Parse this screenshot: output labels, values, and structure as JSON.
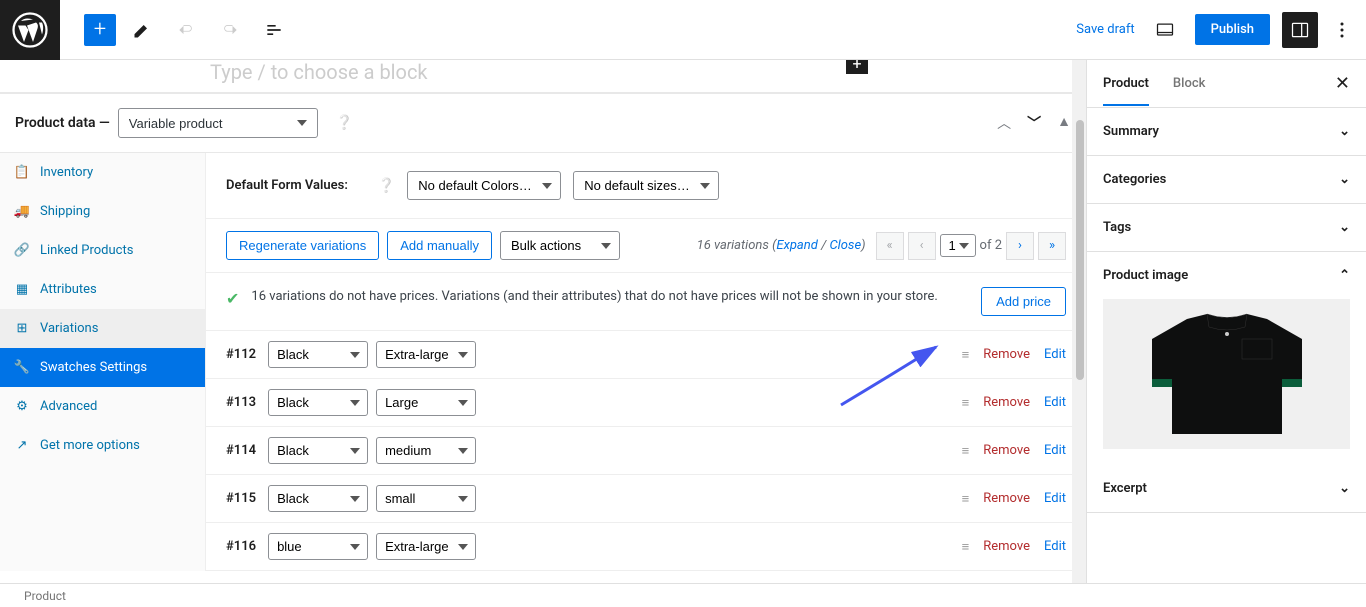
{
  "topbar": {
    "save_draft": "Save draft",
    "publish": "Publish"
  },
  "placeholder_text": "Type / to choose a block",
  "product_data": {
    "label": "Product data —",
    "type": "Variable product"
  },
  "tabs": {
    "inventory": "Inventory",
    "shipping": "Shipping",
    "linked_products": "Linked Products",
    "attributes": "Attributes",
    "variations": "Variations",
    "swatches": "Swatches Settings",
    "advanced": "Advanced",
    "get_more": "Get more options"
  },
  "default_form": {
    "label": "Default Form Values:",
    "colors": "No default Colors…",
    "sizes": "No default sizes…"
  },
  "toolbar": {
    "regenerate": "Regenerate variations",
    "add_manually": "Add manually",
    "bulk_actions": "Bulk actions",
    "variations_count": "16 variations",
    "expand": "Expand",
    "close": "Close",
    "page": "1",
    "of": "of 2"
  },
  "notice": {
    "text": "16 variations do not have prices. Variations (and their attributes) that do not have prices will not be shown in your store.",
    "add_price": "Add price"
  },
  "variations": [
    {
      "id": "#112",
      "color": "Black",
      "size": "Extra-large"
    },
    {
      "id": "#113",
      "color": "Black",
      "size": "Large"
    },
    {
      "id": "#114",
      "color": "Black",
      "size": "medium"
    },
    {
      "id": "#115",
      "color": "Black",
      "size": "small"
    },
    {
      "id": "#116",
      "color": "blue",
      "size": "Extra-large"
    }
  ],
  "row_actions": {
    "remove": "Remove",
    "edit": "Edit"
  },
  "sidebar": {
    "tabs": {
      "product": "Product",
      "block": "Block"
    },
    "panels": {
      "summary": "Summary",
      "categories": "Categories",
      "tags": "Tags",
      "product_image": "Product image",
      "excerpt": "Excerpt"
    }
  },
  "breadcrumb": "Product"
}
